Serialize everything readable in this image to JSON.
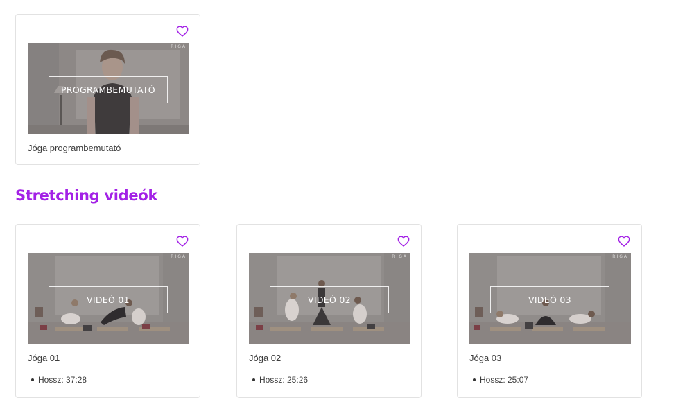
{
  "accent_color": "#a321e6",
  "intro_card": {
    "overlay_label": "PROGRAMBEMUTATÓ",
    "title": "Jóga programbemutató",
    "brand": "RIGA",
    "favorite_icon": "heart-outline-icon"
  },
  "section": {
    "heading": "Stretching videók"
  },
  "videos": [
    {
      "overlay_label": "VIDEÓ 01",
      "title": "Jóga 01",
      "duration": "Hossz: 37:28",
      "brand": "RIGA",
      "favorite_icon": "heart-outline-icon"
    },
    {
      "overlay_label": "VIDEÓ 02",
      "title": "Jóga 02",
      "duration": "Hossz: 25:26",
      "brand": "RIGA",
      "favorite_icon": "heart-outline-icon"
    },
    {
      "overlay_label": "VIDEÓ 03",
      "title": "Jóga 03",
      "duration": "Hossz: 25:07",
      "brand": "RIGA",
      "favorite_icon": "heart-outline-icon"
    }
  ]
}
